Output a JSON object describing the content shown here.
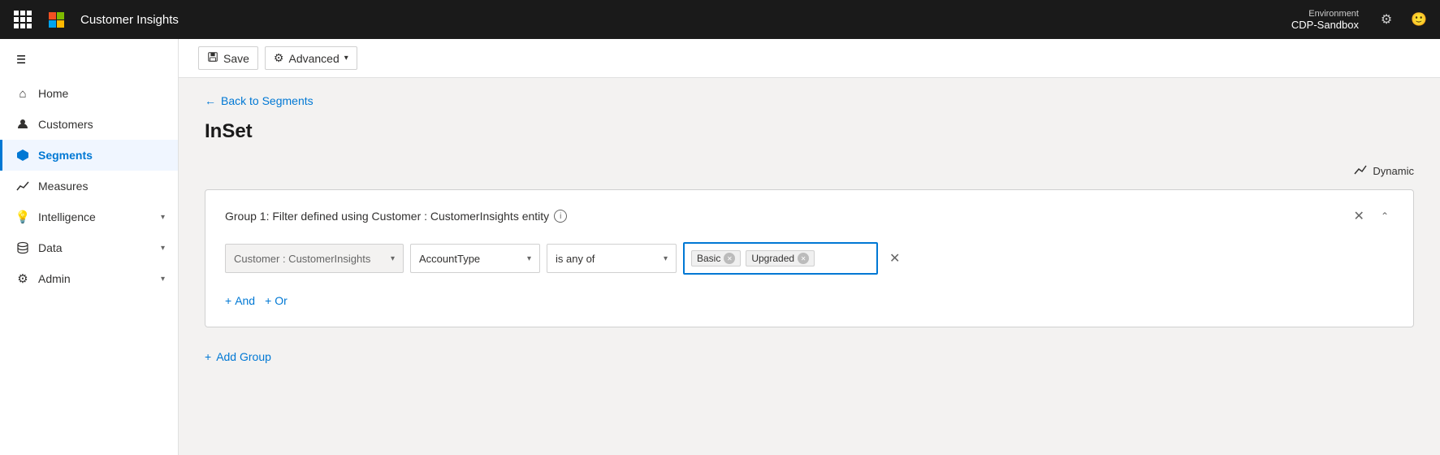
{
  "app": {
    "title": "Customer Insights",
    "environment_label": "Environment",
    "environment_name": "CDP-Sandbox"
  },
  "topbar": {
    "ms_name": "Microsoft"
  },
  "toolbar": {
    "save_label": "Save",
    "advanced_label": "Advanced"
  },
  "back_link": "Back to Segments",
  "page_title": "InSet",
  "dynamic_label": "Dynamic",
  "sidebar": {
    "items": [
      {
        "id": "home",
        "label": "Home",
        "icon": "⌂",
        "active": false
      },
      {
        "id": "customers",
        "label": "Customers",
        "icon": "👤",
        "active": false
      },
      {
        "id": "segments",
        "label": "Segments",
        "icon": "⬡",
        "active": true
      },
      {
        "id": "measures",
        "label": "Measures",
        "icon": "📈",
        "active": false
      },
      {
        "id": "intelligence",
        "label": "Intelligence",
        "icon": "💡",
        "active": false,
        "hasChevron": true
      },
      {
        "id": "data",
        "label": "Data",
        "icon": "🗄",
        "active": false,
        "hasChevron": true
      },
      {
        "id": "admin",
        "label": "Admin",
        "icon": "⚙",
        "active": false,
        "hasChevron": true
      }
    ]
  },
  "group": {
    "title": "Group 1: Filter defined using Customer : CustomerInsights entity",
    "entity_placeholder": "Customer : CustomerInsights",
    "attribute_label": "AccountType",
    "condition_label": "is any of",
    "tags": [
      {
        "label": "Basic"
      },
      {
        "label": "Upgraded"
      }
    ],
    "and_label": "And",
    "or_label": "Or"
  },
  "add_group_label": "Add Group"
}
